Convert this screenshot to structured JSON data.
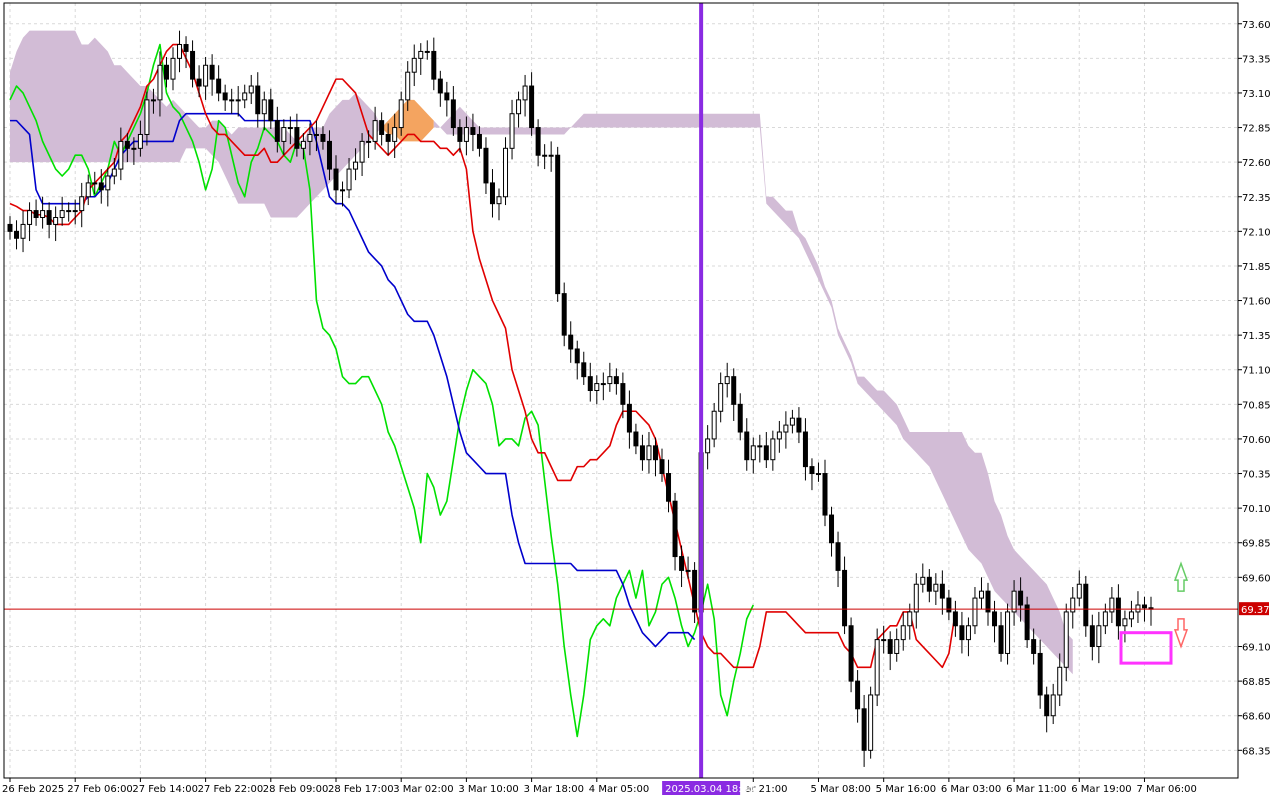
{
  "chart_data": {
    "type": "candlestick",
    "title": "",
    "grid": true,
    "colors": {
      "background": "#ffffff",
      "grid": "#d9d9d9",
      "bull_body": "#ffffff",
      "bear_body": "#000000",
      "candle_border": "#000000",
      "tenkan": "#e00000",
      "kijun": "#0000cc",
      "chikou": "#00e000",
      "cloud_bearish": "#d2bcd6",
      "cloud_bullish": "#f4a460",
      "marker_line": "#8a2be2",
      "price_line": "#cc0000",
      "highlight_box": "#ff33ff",
      "up_arrow": "#66cc66",
      "down_arrow": "#ff6666"
    },
    "y_axis": {
      "ylim": [
        68.15,
        73.75
      ],
      "ticks": [
        "73.60",
        "73.35",
        "73.10",
        "72.85",
        "72.60",
        "72.35",
        "72.10",
        "71.85",
        "71.60",
        "71.35",
        "71.10",
        "70.85",
        "70.60",
        "70.35",
        "70.10",
        "69.85",
        "69.60",
        "69.10",
        "68.85",
        "68.60",
        "68.35"
      ]
    },
    "current_price": "69.37",
    "x_axis": {
      "bars": 184,
      "tick_labels": [
        {
          "label": "26 Feb 2025",
          "bar": 0
        },
        {
          "label": "27 Feb 06:00",
          "bar": 10
        },
        {
          "label": "27 Feb 14:00",
          "bar": 20
        },
        {
          "label": "27 Feb 22:00",
          "bar": 30
        },
        {
          "label": "28 Feb 09:00",
          "bar": 40
        },
        {
          "label": "28 Feb 17:00",
          "bar": 50
        },
        {
          "label": "3 Mar 02:00",
          "bar": 60
        },
        {
          "label": "3 Mar 10:00",
          "bar": 70
        },
        {
          "label": "3 Mar 18:00",
          "bar": 80
        },
        {
          "label": "4 Mar 05:00",
          "bar": 90
        },
        {
          "label": "ar 21:00",
          "bar": 114
        },
        {
          "label": "5 Mar 08:00",
          "bar": 124
        },
        {
          "label": "5 Mar 16:00",
          "bar": 134
        },
        {
          "label": "6 Mar 03:00",
          "bar": 144
        },
        {
          "label": "6 Mar 11:00",
          "bar": 154
        },
        {
          "label": "6 Mar 19:00",
          "bar": 164
        },
        {
          "label": "7 Mar 06:00",
          "bar": 174
        }
      ],
      "marker": {
        "label": "2025.03.04 18:00",
        "bar": 106
      }
    },
    "series": [
      {
        "name": "",
        "role": "close",
        "values": [
          72.1,
          72.05,
          72.15,
          72.25,
          72.2,
          72.25,
          72.15,
          72.2,
          72.25,
          72.25,
          72.25,
          72.35,
          72.45,
          72.45,
          72.4,
          72.5,
          72.55,
          72.75,
          72.7,
          72.7,
          72.8,
          73.05,
          73.05,
          73.3,
          73.2,
          73.35,
          73.45,
          73.4,
          73.2,
          73.15,
          73.3,
          73.2,
          73.1,
          73.05,
          73.05,
          73.05,
          73.1,
          73.15,
          72.95,
          73.05,
          72.9,
          72.75,
          72.85,
          72.85,
          72.7,
          72.75,
          72.8,
          72.8,
          72.75,
          72.55,
          72.4,
          72.4,
          72.55,
          72.6,
          72.75,
          72.75,
          72.9,
          72.8,
          72.75,
          72.85,
          73.05,
          73.25,
          73.35,
          73.4,
          73.4,
          73.2,
          73.1,
          73.05,
          72.85,
          72.75,
          72.85,
          72.8,
          72.7,
          72.45,
          72.3,
          72.35,
          72.7,
          72.95,
          73.05,
          73.15,
          72.85,
          72.65,
          72.65,
          72.65,
          71.65,
          71.35,
          71.25,
          71.15,
          71.05,
          70.95,
          71.0,
          71.0,
          71.05,
          71.0,
          70.85,
          70.65,
          70.55,
          70.45,
          70.55,
          70.45,
          70.35,
          70.15,
          69.75,
          69.65,
          69.65,
          69.35,
          70.5,
          70.6,
          70.8,
          71.0,
          71.05,
          70.85,
          70.65,
          70.45,
          70.55,
          70.55,
          70.45,
          70.6,
          70.65,
          70.7,
          70.75,
          70.65,
          70.4,
          70.35,
          70.35,
          70.05,
          69.85,
          69.65,
          69.25,
          68.85,
          68.65,
          68.35,
          68.75,
          69.15,
          69.15,
          69.05,
          69.15,
          69.25,
          69.35,
          69.55,
          69.6,
          69.5,
          69.55,
          69.45,
          69.35,
          69.25,
          69.15,
          69.25,
          69.45,
          69.5,
          69.35,
          69.25,
          69.05,
          69.35,
          69.5,
          69.4,
          69.15,
          69.05,
          68.75,
          68.6,
          68.75,
          68.95,
          69.35,
          69.45,
          69.55,
          69.25,
          69.1,
          69.25,
          69.35,
          69.45,
          69.25,
          69.3,
          69.35,
          69.4,
          69.38,
          69.37
        ]
      },
      {
        "name": "",
        "role": "tenkan",
        "values": [
          72.3,
          72.28,
          72.25,
          72.25,
          72.22,
          72.22,
          72.2,
          72.15,
          72.15,
          72.15,
          72.2,
          72.25,
          72.4,
          72.45,
          72.5,
          72.55,
          72.6,
          72.75,
          72.8,
          72.9,
          73.0,
          73.15,
          73.2,
          73.3,
          73.4,
          73.45,
          73.45,
          73.35,
          73.25,
          73.1,
          72.95,
          72.85,
          72.8,
          72.8,
          72.75,
          72.7,
          72.65,
          72.65,
          72.65,
          72.7,
          72.6,
          72.6,
          72.65,
          72.7,
          72.75,
          72.8,
          72.85,
          72.9,
          73.0,
          73.1,
          73.2,
          73.2,
          73.15,
          73.1,
          72.95,
          72.8,
          72.75,
          72.7,
          72.65,
          72.7,
          72.75,
          72.8,
          72.8,
          72.75,
          72.75,
          72.75,
          72.7,
          72.7,
          72.65,
          72.7,
          72.55,
          72.1,
          71.9,
          71.75,
          71.6,
          71.5,
          71.4,
          71.1,
          70.95,
          70.8,
          70.6,
          70.5,
          70.5,
          70.4,
          70.3,
          70.3,
          70.3,
          70.4,
          70.4,
          70.45,
          70.45,
          70.5,
          70.55,
          70.7,
          70.8,
          70.8,
          70.8,
          70.75,
          70.7,
          70.6,
          70.4,
          70.2,
          70.0,
          69.8,
          69.6,
          69.4,
          69.2,
          69.1,
          69.05,
          69.05,
          69.0,
          68.95,
          68.95,
          68.95,
          68.95,
          69.1,
          69.35,
          69.35,
          69.35,
          69.35,
          69.3,
          69.25,
          69.2,
          69.2,
          69.2,
          69.2,
          69.2,
          69.2,
          69.1,
          69.05,
          68.95,
          68.95,
          68.95,
          69.15,
          69.2,
          69.25,
          69.25,
          69.35,
          69.35,
          69.15,
          69.1,
          69.05,
          69.0,
          68.95,
          69.05,
          69.35
        ]
      },
      {
        "name": "",
        "role": "kijun",
        "values": [
          72.9,
          72.9,
          72.85,
          72.8,
          72.4,
          72.3,
          72.3,
          72.3,
          72.3,
          72.3,
          72.3,
          72.3,
          72.35,
          72.35,
          72.4,
          72.45,
          72.55,
          72.65,
          72.7,
          72.75,
          72.75,
          72.75,
          72.75,
          72.75,
          72.75,
          72.75,
          72.9,
          72.95,
          72.95,
          72.95,
          72.95,
          72.95,
          72.95,
          72.95,
          72.95,
          72.95,
          72.9,
          72.9,
          72.9,
          72.9,
          72.9,
          72.9,
          72.9,
          72.9,
          72.9,
          72.9,
          72.9,
          72.75,
          72.55,
          72.35,
          72.3,
          72.3,
          72.25,
          72.15,
          72.05,
          71.95,
          71.9,
          71.85,
          71.75,
          71.7,
          71.6,
          71.5,
          71.45,
          71.45,
          71.45,
          71.35,
          71.2,
          71.05,
          70.85,
          70.65,
          70.5,
          70.45,
          70.4,
          70.35,
          70.35,
          70.35,
          70.35,
          70.05,
          69.85,
          69.7,
          69.7,
          69.7,
          69.7,
          69.7,
          69.7,
          69.7,
          69.7,
          69.65,
          69.65,
          69.65,
          69.65,
          69.65,
          69.65,
          69.65,
          69.55,
          69.4,
          69.3,
          69.2,
          69.15,
          69.1,
          69.15,
          69.2,
          69.2,
          69.2,
          69.2,
          69.15
        ]
      },
      {
        "name": "",
        "role": "chikou",
        "values": [
          73.05,
          73.15,
          73.1,
          73.0,
          72.9,
          72.75,
          72.65,
          72.55,
          72.5,
          72.55,
          72.65,
          72.65,
          72.55,
          72.35,
          72.45,
          72.55,
          72.75,
          72.65,
          72.75,
          72.85,
          72.95,
          73.1,
          73.3,
          73.45,
          73.1,
          73.0,
          72.95,
          72.85,
          72.75,
          72.6,
          72.4,
          72.55,
          72.9,
          72.85,
          72.65,
          72.45,
          72.35,
          72.6,
          72.7,
          72.85,
          72.8,
          72.75,
          72.65,
          72.6,
          72.75,
          72.7,
          72.4,
          71.6,
          71.4,
          71.35,
          71.25,
          71.05,
          71.0,
          71.0,
          71.05,
          71.05,
          70.95,
          70.85,
          70.65,
          70.55,
          70.4,
          70.25,
          70.1,
          69.85,
          70.35,
          70.25,
          70.05,
          70.15,
          70.45,
          70.75,
          70.95,
          71.1,
          71.05,
          71.0,
          70.85,
          70.55,
          70.6,
          70.6,
          70.55,
          70.75,
          70.8,
          70.7,
          70.3,
          69.9,
          69.55,
          69.1,
          68.75,
          68.45,
          68.75,
          69.15,
          69.25,
          69.3,
          69.25,
          69.45,
          69.55,
          69.65,
          69.45,
          69.65,
          69.25,
          69.35,
          69.55,
          69.6,
          69.45,
          69.25,
          69.1,
          69.2,
          69.35,
          69.55,
          69.3,
          68.75,
          68.6,
          68.85,
          69.05,
          69.3,
          69.4
        ]
      },
      {
        "name": "",
        "role": "senkou_a",
        "values": [
          73.25,
          73.4,
          73.5,
          73.55,
          73.55,
          73.55,
          73.55,
          73.55,
          73.55,
          73.55,
          73.55,
          73.45,
          73.45,
          73.5,
          73.45,
          73.4,
          73.3,
          73.3,
          73.25,
          73.2,
          73.15,
          73.15,
          73.1,
          73.05,
          73.0,
          73.05,
          73.0,
          72.95,
          72.9,
          72.85,
          72.85,
          72.9,
          72.9,
          72.85,
          72.8,
          72.85,
          72.85,
          72.85,
          72.85,
          72.85,
          72.85,
          72.85,
          72.85,
          72.8,
          72.75,
          72.75,
          72.85,
          72.85,
          72.85,
          72.95,
          73.0,
          73.05,
          73.05,
          73.1,
          73.05,
          73.0,
          72.95,
          72.85,
          72.8,
          72.8,
          72.75,
          72.75,
          72.75,
          72.75,
          72.8,
          72.85,
          72.85,
          72.9,
          72.95,
          73.0,
          72.95,
          72.9,
          72.85,
          72.85,
          72.85,
          72.85,
          72.85,
          72.85,
          72.85,
          72.85,
          72.85,
          72.85,
          72.85,
          72.85,
          72.85,
          72.85,
          72.85,
          72.9,
          72.95,
          72.95,
          72.95,
          72.95,
          72.95,
          72.95,
          72.95,
          72.95,
          72.95,
          72.95,
          72.95,
          72.95,
          72.95,
          72.95,
          72.95,
          72.95,
          72.95,
          72.95,
          72.95,
          72.95,
          72.95,
          72.95,
          72.95,
          72.95,
          72.95,
          72.95,
          72.95,
          72.95,
          72.35,
          72.35,
          72.3,
          72.25,
          72.25,
          72.1,
          72.05,
          71.95,
          71.85,
          71.7,
          71.6,
          71.4,
          71.3,
          71.2,
          71.05,
          71.05,
          71.0,
          70.95,
          70.95,
          70.9,
          70.85,
          70.75,
          70.65,
          70.65,
          70.65,
          70.65,
          70.65,
          70.65,
          70.65,
          70.65,
          70.65,
          70.55,
          70.5,
          70.5,
          70.35,
          70.15,
          70.05,
          69.9,
          69.8,
          69.75,
          69.7,
          69.65,
          69.6,
          69.55,
          69.45,
          69.35,
          69.2,
          69.15
        ]
      },
      {
        "name": "",
        "role": "senkou_b",
        "values": [
          72.6,
          72.6,
          72.6,
          72.6,
          72.6,
          72.6,
          72.6,
          72.6,
          72.6,
          72.6,
          72.6,
          72.6,
          72.6,
          72.6,
          72.6,
          72.6,
          72.6,
          72.6,
          72.6,
          72.6,
          72.6,
          72.6,
          72.6,
          72.6,
          72.6,
          72.6,
          72.6,
          72.7,
          72.7,
          72.7,
          72.7,
          72.65,
          72.6,
          72.5,
          72.4,
          72.3,
          72.3,
          72.3,
          72.3,
          72.3,
          72.2,
          72.2,
          72.2,
          72.2,
          72.2,
          72.25,
          72.3,
          72.35,
          72.4,
          72.45,
          72.5,
          72.55,
          72.6,
          72.65,
          72.7,
          72.75,
          72.8,
          72.85,
          72.9,
          72.95,
          73.0,
          73.05,
          73.05,
          73.0,
          72.95,
          72.9,
          72.85,
          72.8,
          72.8,
          72.8,
          72.8,
          72.8,
          72.8,
          72.8,
          72.8,
          72.8,
          72.8,
          72.8,
          72.8,
          72.8,
          72.8,
          72.8,
          72.8,
          72.8,
          72.8,
          72.8,
          72.85,
          72.85,
          72.85,
          72.85,
          72.85,
          72.85,
          72.85,
          72.85,
          72.85,
          72.85,
          72.85,
          72.85,
          72.85,
          72.85,
          72.85,
          72.85,
          72.85,
          72.85,
          72.85,
          72.85,
          72.85,
          72.85,
          72.85,
          72.85,
          72.85,
          72.85,
          72.85,
          72.85,
          72.85,
          72.85,
          72.3,
          72.25,
          72.2,
          72.15,
          72.1,
          72.05,
          71.95,
          71.85,
          71.75,
          71.65,
          71.55,
          71.35,
          71.25,
          71.15,
          71.0,
          70.95,
          70.9,
          70.85,
          70.8,
          70.75,
          70.7,
          70.6,
          70.55,
          70.5,
          70.45,
          70.4,
          70.3,
          70.2,
          70.1,
          70.0,
          69.9,
          69.8,
          69.75,
          69.7,
          69.6,
          69.5,
          69.45,
          69.4,
          69.35,
          69.3,
          69.25,
          69.2,
          69.15,
          69.1,
          69.05,
          69.0,
          68.95,
          68.9
        ]
      }
    ]
  }
}
